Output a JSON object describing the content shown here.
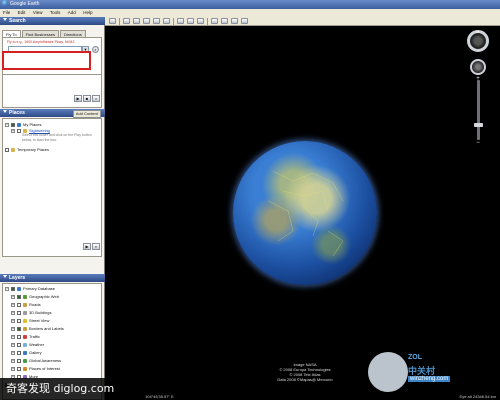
{
  "window": {
    "title": "Google Earth"
  },
  "menu": [
    "File",
    "Edit",
    "View",
    "Tools",
    "Add",
    "Help"
  ],
  "search": {
    "header": "Search",
    "tabs": [
      "Fly To",
      "Find Businesses",
      "Directions"
    ],
    "hint": "Fly to e.g., 1600 Amphitheatre Pkwy, 94043",
    "input_value": ""
  },
  "places": {
    "header": "Places",
    "add_content": "Add Content",
    "my_places": "My Places",
    "sightseeing": "Sightseeing",
    "tour_hint": "Select this folder and click on the Play button below, to start the tour.",
    "temporary": "Temporary Places"
  },
  "layers": {
    "header": "Layers",
    "items": [
      "Primary Database",
      "Geographic Web",
      "Roads",
      "3D Buildings",
      "Street View",
      "Borders and Labels",
      "Traffic",
      "Weather",
      "Gallery",
      "Global Awareness",
      "Places of Interest",
      "More",
      "Terrain"
    ]
  },
  "map": {
    "credits": [
      "Image NASA",
      "© 2008 Europa Technologies",
      "© 2008 Tele Atlas",
      "Data 2008 ©Mapas@ Mercurio"
    ],
    "status_left": "104°46'35.57\" E",
    "status_right": "Eye alt 24346.54 km"
  },
  "logo": {
    "zol": "ZOL",
    "cn": "中关村",
    "url": "winzheng.com"
  },
  "watermark": "奇客发现 diglog.com",
  "colors": {
    "highlight_box": "#d42020",
    "panel_header": "#3d5f9e"
  }
}
